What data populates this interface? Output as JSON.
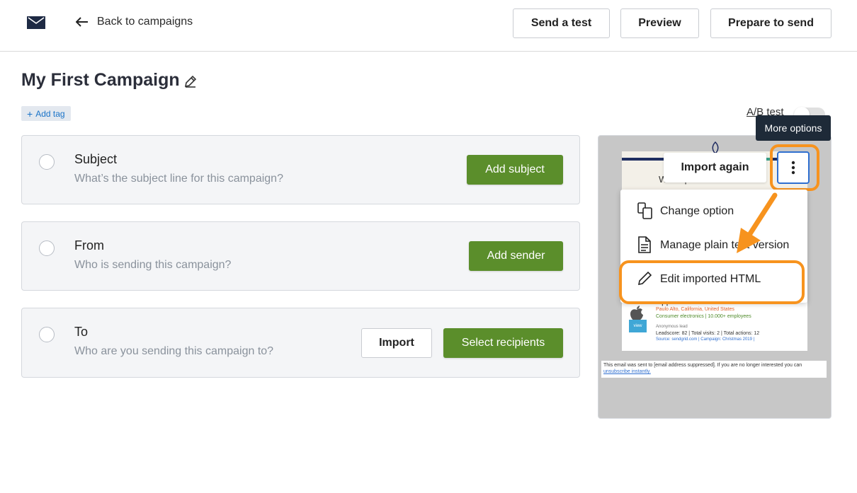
{
  "header": {
    "back_label": "Back to campaigns",
    "buttons": {
      "send_test": "Send a test",
      "preview": "Preview",
      "prepare": "Prepare to send"
    }
  },
  "campaign": {
    "title": "My First Campaign",
    "add_tag": "Add tag",
    "ab_test_label": "A/B test",
    "ab_test_enabled": false
  },
  "steps": [
    {
      "title": "Subject",
      "subtitle": "What’s the subject line for this campaign?",
      "action": "Add subject"
    },
    {
      "title": "From",
      "subtitle": "Who is sending this campaign?",
      "action": "Add sender"
    },
    {
      "title": "To",
      "subtitle": "Who are you sending this campaign to?",
      "secondary_action": "Import",
      "action": "Select recipients"
    }
  ],
  "preview": {
    "import_again": "Import again",
    "tooltip": "More options",
    "menu": [
      {
        "label": "Change option",
        "icon": "change-option-icon"
      },
      {
        "label": "Manage plain text version",
        "icon": "document-icon"
      },
      {
        "label": "Edit imported HTML",
        "icon": "pencil-icon"
      }
    ],
    "email": {
      "heading": "We captured activities for",
      "company": "Apple Inc.",
      "location": "Paulo Alto, California, United States",
      "industry": "Consumer electronics | 10.000+ employees",
      "lead_type": "Anonymous lead",
      "stats": "Leadscore: 82 | Total visits: 2 | Total actions: 12",
      "source": "Source: sendgrid.com | Campaign: Christmas 2019 |",
      "view_label": "view",
      "footer_text": "This email was sent to [email address suppressed]. If you are no longer interested you can",
      "footer_link": "unsubscribe instantly."
    }
  },
  "colors": {
    "green": "#5b8e2b",
    "highlight_orange": "#f7931e",
    "tooltip_bg": "#1e2a38",
    "focus_blue": "#2f6fd0"
  }
}
